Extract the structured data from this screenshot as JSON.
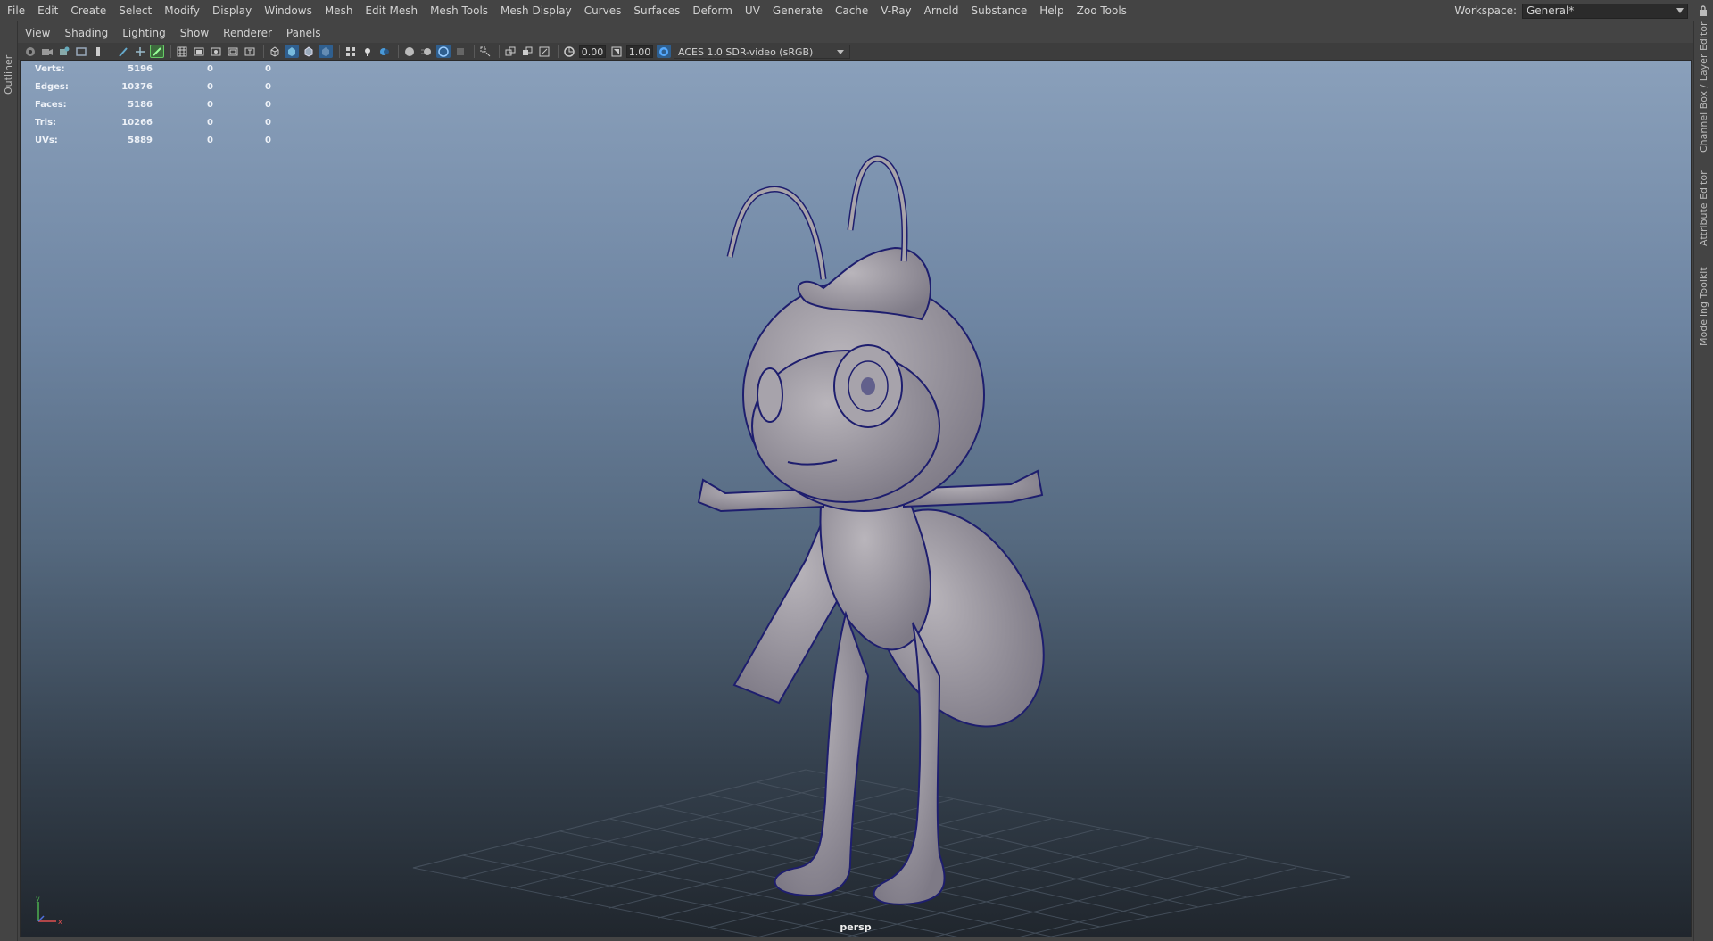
{
  "menubar": {
    "items": [
      "File",
      "Edit",
      "Create",
      "Select",
      "Modify",
      "Display",
      "Windows",
      "Mesh",
      "Edit Mesh",
      "Mesh Tools",
      "Mesh Display",
      "Curves",
      "Surfaces",
      "Deform",
      "UV",
      "Generate",
      "Cache",
      "V-Ray",
      "Arnold",
      "Substance",
      "Help",
      "Zoo Tools"
    ]
  },
  "workspace": {
    "label": "Workspace:",
    "value": "General*"
  },
  "side_tabs": {
    "left": "Outliner",
    "right": [
      "Channel Box / Layer Editor",
      "Attribute Editor",
      "Modeling Toolkit"
    ]
  },
  "panel_menu": {
    "items": [
      "View",
      "Shading",
      "Lighting",
      "Show",
      "Renderer",
      "Panels"
    ]
  },
  "toolbar": {
    "exposure": "0.00",
    "gamma": "1.00",
    "color_space": "ACES 1.0 SDR-video (sRGB)",
    "icons": [
      "select-camera-icon",
      "camera-attributes-icon",
      "bookmark-icon",
      "image-plane-icon",
      "2d-pan-zoom-icon",
      "grease-pencil-icon",
      "grid-icon",
      "film-gate-icon",
      "resolution-gate-icon",
      "gate-mask-icon",
      "field-chart-icon",
      "safe-action-icon",
      "safe-title-icon",
      "wireframe-icon",
      "smooth-shade-icon",
      "wireframe-on-shaded-icon",
      "xray-icon",
      "textured-icon",
      "use-lights-icon",
      "shadows-icon",
      "ambient-occlusion-icon",
      "motion-blur-icon",
      "anti-aliasing-icon",
      "isolate-select-icon",
      "xray-joints-icon",
      "xray-active-icon",
      "exposure-icon",
      "gamma-icon",
      "color-management-icon"
    ]
  },
  "hud": {
    "rows": [
      {
        "label": "Verts:",
        "v1": "5196",
        "v2": "0",
        "v3": "0"
      },
      {
        "label": "Edges:",
        "v1": "10376",
        "v2": "0",
        "v3": "0"
      },
      {
        "label": "Faces:",
        "v1": "5186",
        "v2": "0",
        "v3": "0"
      },
      {
        "label": "Tris:",
        "v1": "10266",
        "v2": "0",
        "v3": "0"
      },
      {
        "label": "UVs:",
        "v1": "5889",
        "v2": "0",
        "v3": "0"
      }
    ]
  },
  "viewport": {
    "camera": "persp",
    "axis_y": "y",
    "axis_x": "x"
  },
  "colors": {
    "viewport_top": "#8aa0bb",
    "viewport_bottom": "#20262d",
    "wireframe": "#1e1e6e",
    "mesh": "#a8a4aa",
    "active_icon": "#3a8fd9"
  }
}
